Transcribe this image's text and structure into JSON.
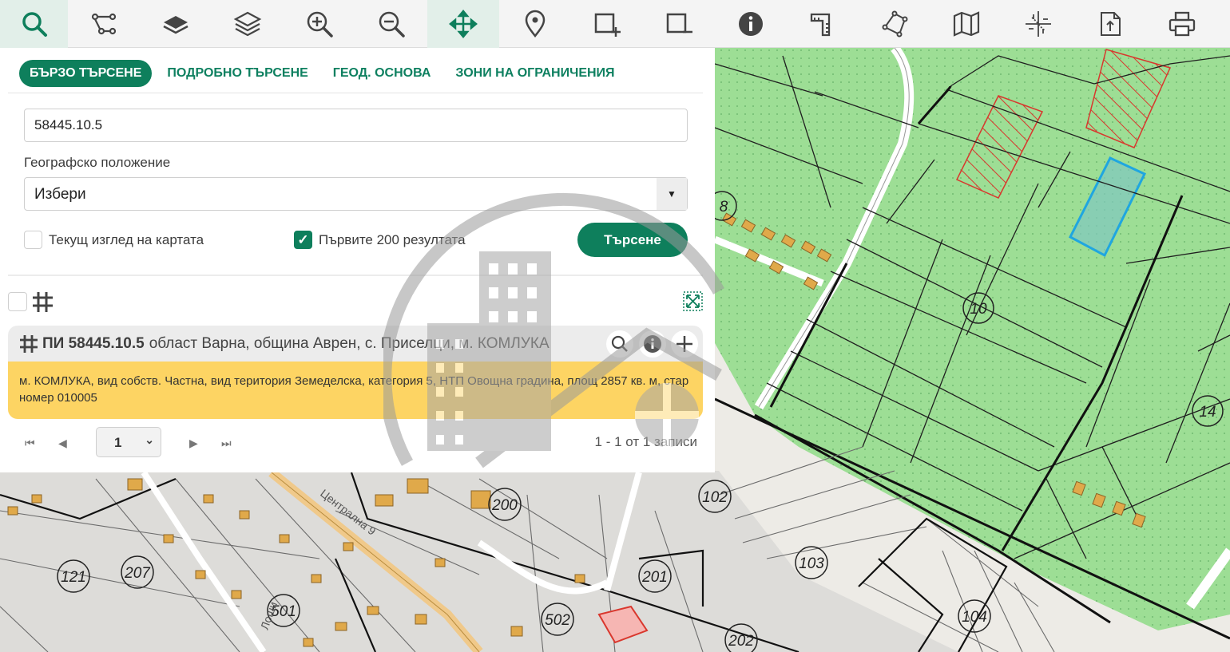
{
  "toolbar": {
    "tools": [
      {
        "icon": "search-icon",
        "active": true
      },
      {
        "icon": "route-icon"
      },
      {
        "icon": "layer-icon"
      },
      {
        "icon": "layers-icon"
      },
      {
        "icon": "zoom-in-icon"
      },
      {
        "icon": "zoom-out-icon"
      },
      {
        "icon": "pan-icon",
        "active": true
      },
      {
        "icon": "location-pin-icon"
      },
      {
        "icon": "select-add-icon"
      },
      {
        "icon": "select-remove-icon"
      },
      {
        "icon": "info-icon"
      },
      {
        "icon": "measure-icon"
      },
      {
        "icon": "polygon-icon"
      },
      {
        "icon": "map-icon"
      },
      {
        "icon": "coordinates-icon"
      },
      {
        "icon": "export-icon"
      },
      {
        "icon": "print-icon"
      }
    ]
  },
  "tabs": [
    "БЪРЗО ТЪРСЕНЕ",
    "ПОДРОБНО ТЪРСЕНЕ",
    "ГЕОД. ОСНОВА",
    "ЗОНИ НА ОГРАНИЧЕНИЯ"
  ],
  "search": {
    "query": "58445.10.5",
    "geo_label": "Географско положение",
    "geo_value": "Избери",
    "current_view_label": "Текущ изглед на картата",
    "first200_label": "Първите 200 резултата",
    "button": "Търсене"
  },
  "result": {
    "id": "ПИ 58445.10.5",
    "location": "област Варна, община Аврен, с. Приселци, м. КОМЛУКА",
    "details": "м. КОМЛУКА, вид собств. Частна, вид територия Земеделска, категория 5, НТП Овощна градина, площ 2857 кв. м, стар номер 010005"
  },
  "pager": {
    "first": "⏮",
    "prev": "◀",
    "page": "1",
    "next": "▶",
    "last": "⏭",
    "info": "1 - 1 от 1 записи"
  },
  "map": {
    "labels": [
      "8",
      "10",
      "14",
      "102",
      "103",
      "104",
      "200",
      "201",
      "202",
      "121",
      "207",
      "501",
      "502"
    ],
    "street_labels": [
      "Централна 9",
      "Лоши"
    ],
    "colors": {
      "agri": "#9dde95",
      "urban": "#edebe6",
      "selected": "#3cb4d8",
      "building": "#e0a94a",
      "hatched": "#d9372d"
    }
  }
}
